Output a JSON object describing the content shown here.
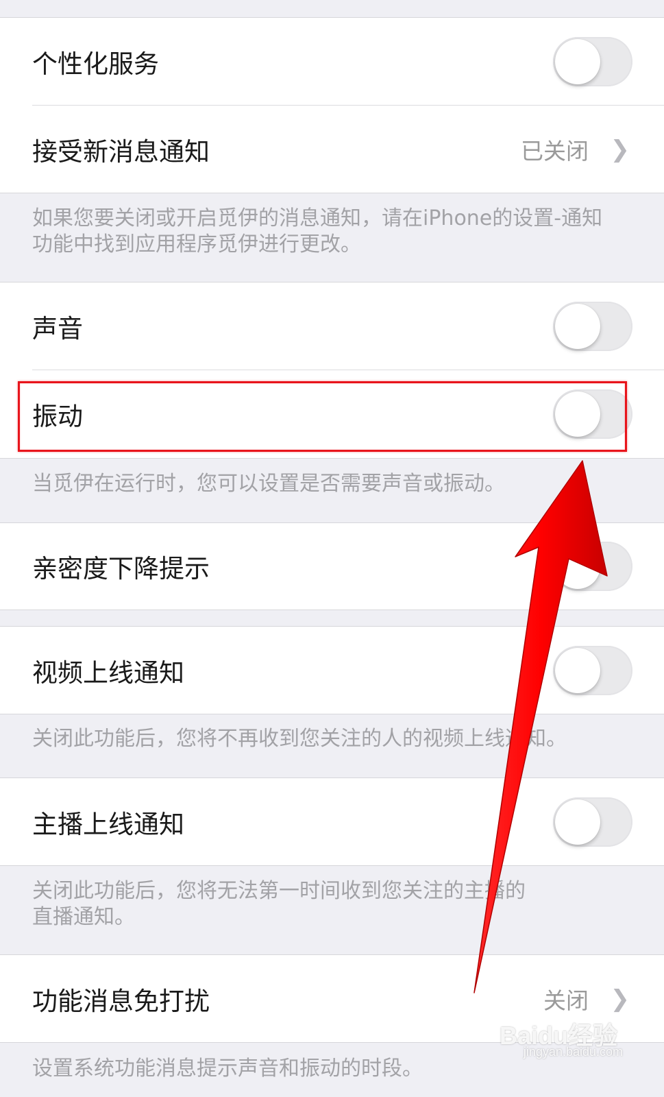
{
  "settings": {
    "personalized_service": {
      "label": "个性化服务",
      "enabled": false
    },
    "new_message_notify": {
      "label": "接受新消息通知",
      "value": "已关闭"
    },
    "notify_note": "如果您要关闭或开启觅伊的消息通知，请在iPhone的设置-通知\n功能中找到应用程序觅伊进行更改。",
    "sound": {
      "label": "声音",
      "enabled": false
    },
    "vibration": {
      "label": "振动",
      "enabled": false
    },
    "sound_note": "当觅伊在运行时，您可以设置是否需要声音或振动。",
    "intimacy_drop": {
      "label": "亲密度下降提示",
      "enabled": false
    },
    "video_online": {
      "label": "视频上线通知",
      "enabled": false
    },
    "video_note": "关闭此功能后，您将不再收到您关注的人的视频上线通知。",
    "anchor_online": {
      "label": "主播上线通知",
      "enabled": false
    },
    "anchor_note": "关闭此功能后，您将无法第一时间收到您关注的主播的\n直播通知。",
    "function_dnd": {
      "label": "功能消息免打扰",
      "value": "关闭"
    },
    "dnd_note": "设置系统功能消息提示声音和振动的时段。"
  },
  "watermark": {
    "brand": "Baidu经验",
    "url": "jingyan.baidu.com"
  },
  "colors": {
    "background": "#efeff4",
    "annotation_red": "#e8141b",
    "toggle_off": "#e9e9eb"
  },
  "icons": {
    "chevron": "chevron-right-icon",
    "annotation": "red-arrow-icon"
  }
}
